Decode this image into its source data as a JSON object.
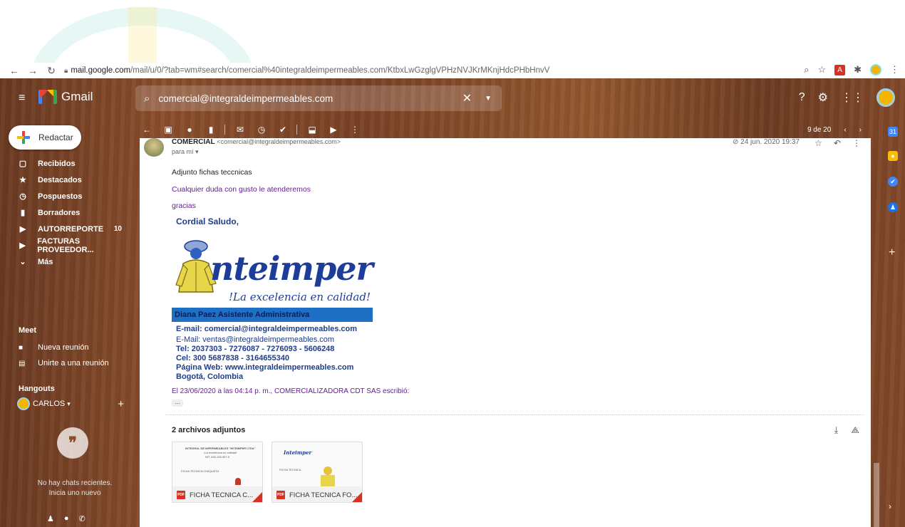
{
  "browser": {
    "url_domain": "mail.google.com",
    "url_path": "/mail/u/0/?tab=wm#search/comercial%40integraldeimpermeables.com/KtbxLwGzglgVPHzNVJKrMKnjHdcPHbHnvV",
    "ext_label": "A"
  },
  "app": {
    "name": "Gmail"
  },
  "search": {
    "query": "comercial@integraldeimpermeables.com"
  },
  "compose": {
    "label": "Redactar"
  },
  "sidebar": {
    "items": [
      {
        "label": "Recibidos",
        "icon": "inbox-icon",
        "glyph": "▢"
      },
      {
        "label": "Destacados",
        "icon": "star-icon",
        "glyph": "★"
      },
      {
        "label": "Pospuestos",
        "icon": "clock-icon",
        "glyph": "◷"
      },
      {
        "label": "Borradores",
        "icon": "draft-icon",
        "glyph": "▮"
      },
      {
        "label": "AUTORREPORTE",
        "icon": "label-icon",
        "glyph": "▶",
        "count": "10"
      },
      {
        "label": "FACTURAS PROVEEDOR...",
        "icon": "label-icon",
        "glyph": "▶"
      },
      {
        "label": "Más",
        "icon": "chevron-down-icon",
        "glyph": "⌄"
      }
    ],
    "meet_title": "Meet",
    "meet_new": "Nueva reunión",
    "meet_join": "Unirte a una reunión",
    "hangouts_title": "Hangouts",
    "user_name": "CARLOS",
    "no_chats_1": "No hay chats recientes.",
    "no_chats_2": "Inicia uno nuevo"
  },
  "toolbar": {
    "pager": "9 de 20"
  },
  "message": {
    "sender_name": "COMERCIAL",
    "sender_email": "<comercial@integraldeimpermeables.com>",
    "to": "para mí",
    "date": "24 jun. 2020 19:37",
    "lines": [
      "Adjunto fichas teccnicas",
      "Cualquier duda con gusto le atenderemos",
      "gracias"
    ],
    "quoted_header": "El 23/06/2020 a las 04:14 p. m., COMERCIALIZADORA CDT SAS escribió:"
  },
  "signature": {
    "greeting": "Cordial Saludo,",
    "brand": "nteimper",
    "tagline": "!La excelencia en calidad!",
    "band": "Diana Paez Asistente Administrativa",
    "email_main": "E-mail: comercial@integraldeimpermeables.com",
    "email_sales": "E-Mail:  ventas@integraldeimpermeables.com",
    "tel": "Tel: 2037303 - 7276087 - 7276093 - 5606248",
    "cel": "Cel: 300 5687838 - 3164655340",
    "web": "Página Web: www.integraldeimpermeables.com",
    "city": "Bogotá, Colombia"
  },
  "attachments": {
    "title": "2 archivos adjuntos",
    "files": [
      {
        "name": "FICHA TECNICA C...",
        "preview_title": "INTEGRAL DE IMPERMEABLES \"INTEIMPER LTDA\"",
        "preview_sub": "¡La excelencia en calidad!",
        "preview_nit": "NIT. 830.108.397-5",
        "preview_label": "FICHA TECNICA CHAQUETA"
      },
      {
        "name": "FICHA TECNICA FO...",
        "preview_brand": "Inteimper",
        "preview_label": "FICHA TECNICA"
      }
    ]
  },
  "colors": {
    "accent_purple": "#6a1b9a",
    "brand_blue": "#1e3c9a",
    "pdf_red": "#d93025"
  }
}
